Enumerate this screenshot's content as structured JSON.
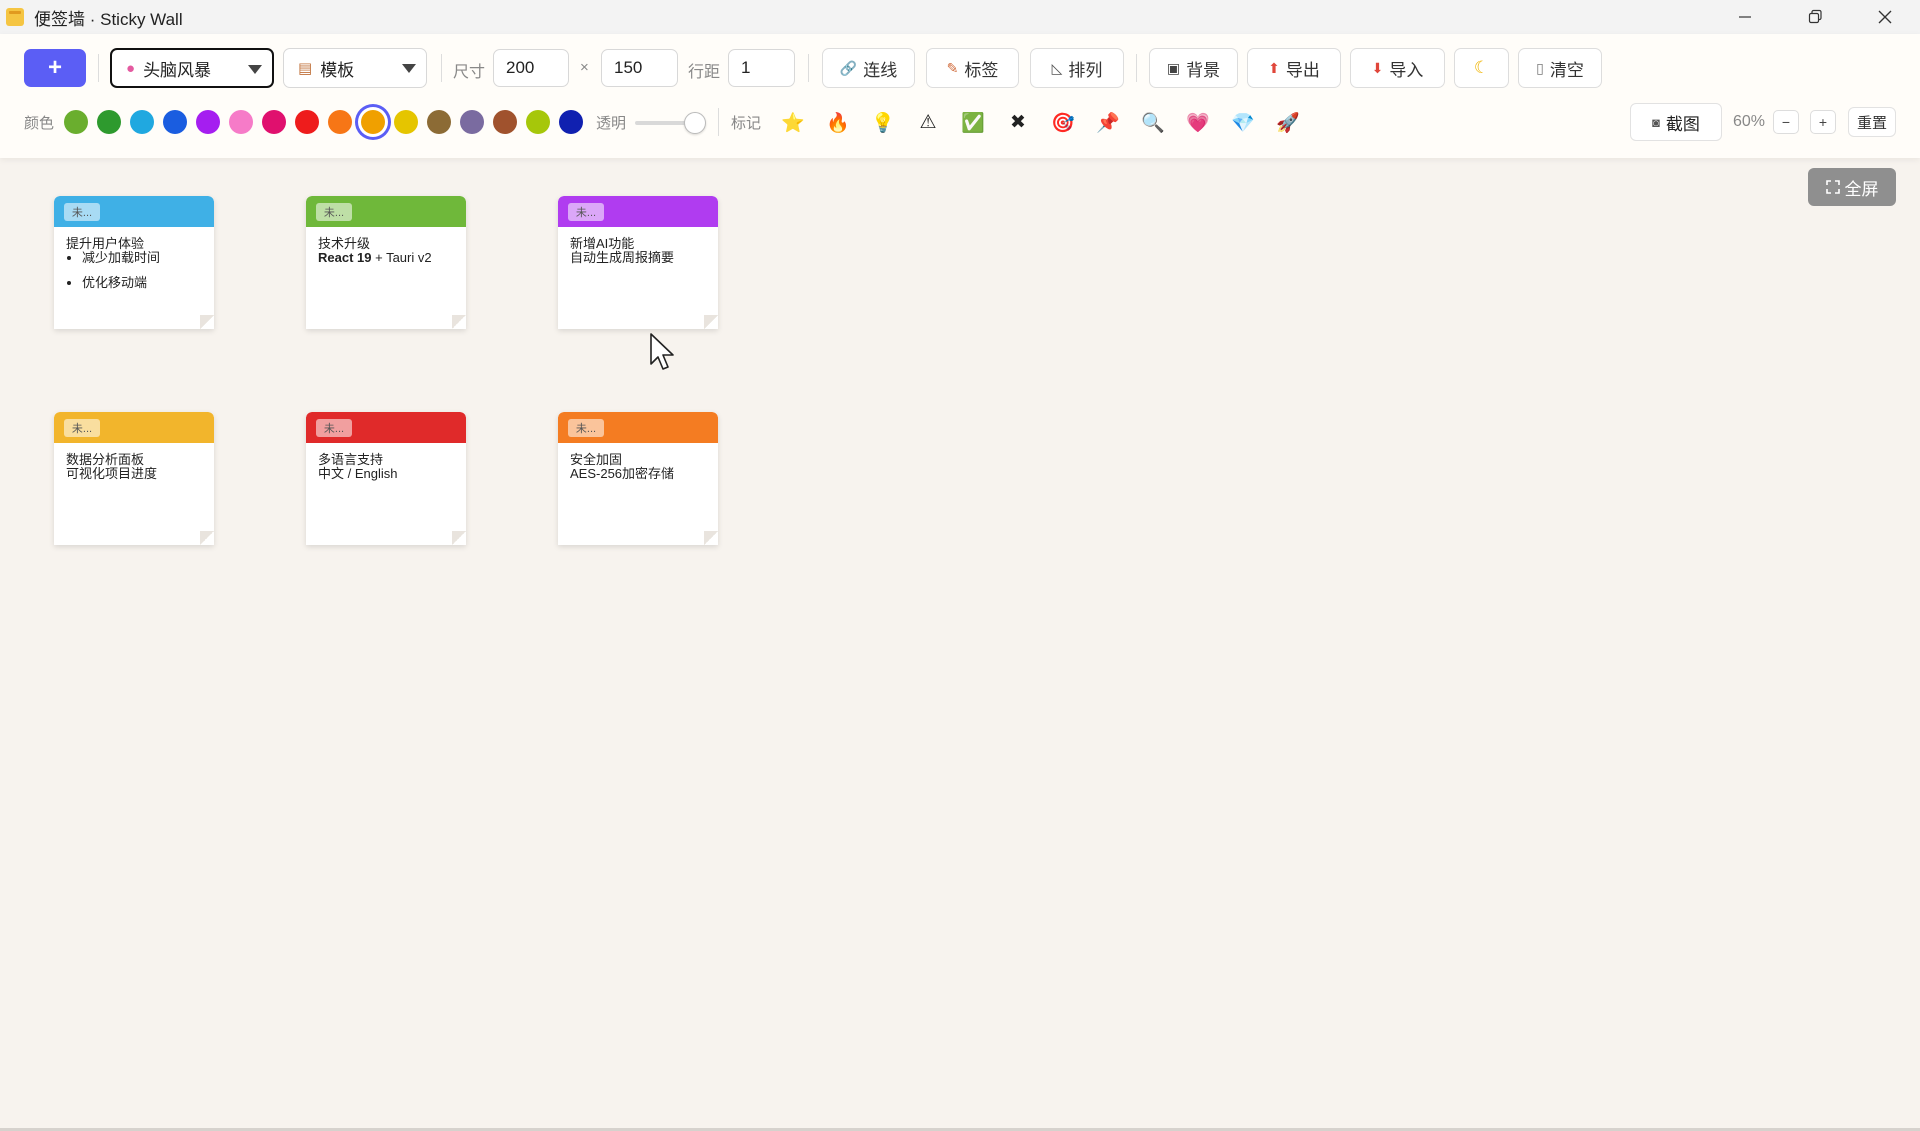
{
  "window": {
    "title": "便签墙 · Sticky Wall",
    "minimize_icon": "minimize-icon",
    "restore_icon": "restore-icon",
    "close_icon": "close-icon"
  },
  "toolbar": {
    "add_label": "+",
    "mode_select": {
      "value": "头脑风暴",
      "icon": "brain-icon"
    },
    "template_select": {
      "value": "模板",
      "icon": "clipboard-icon"
    },
    "size_label": "尺寸",
    "width_value": "200",
    "times": "×",
    "height_value": "150",
    "spacing_label": "行距",
    "spacing_value": "1",
    "link_label": "连线",
    "tag_label": "标签",
    "arrange_label": "排列",
    "background_label": "背景",
    "export_label": "导出",
    "import_label": "导入",
    "theme_icon": "moon-icon",
    "clear_label": "清空",
    "color_label": "颜色",
    "colors": [
      "#6aae2e",
      "#2e9a2e",
      "#20a8e0",
      "#1a5de0",
      "#a51ef0",
      "#f67bc8",
      "#e0106e",
      "#ee1c1c",
      "#f77616",
      "#f0a000",
      "#e5c500",
      "#8c6b35",
      "#7a6ba0",
      "#a0522d",
      "#a6c70a",
      "#1020b0"
    ],
    "selected_color_index": 9,
    "opacity_label": "透明",
    "opacity_value": 1.0,
    "mark_label": "标记",
    "marks": [
      "⭐",
      "🔥",
      "💡",
      "⚠",
      "✅",
      "✖",
      "🎯",
      "📌",
      "🔍",
      "💗",
      "💎",
      "🚀"
    ],
    "mark_names": [
      "star-icon",
      "fire-icon",
      "bulb-icon",
      "warning-icon",
      "check-icon",
      "cross-icon",
      "target-icon",
      "pin-icon",
      "search-icon",
      "heart-icon",
      "diamond-icon",
      "rocket-icon"
    ],
    "screenshot_label": "截图",
    "zoom_value": "60%",
    "zoom_out_label": "−",
    "zoom_in_label": "+",
    "reset_label": "重置"
  },
  "fullscreen_label": "全屏",
  "notes": [
    {
      "tag": "未...",
      "color": "#3fb0e6",
      "line1": "提升用户体验",
      "bullets": [
        "减少加载时间",
        "优化移动端"
      ]
    },
    {
      "tag": "未...",
      "color": "#6fb83a",
      "line1": "技术升级",
      "bold": "React 19",
      "rest": " + Tauri v2"
    },
    {
      "tag": "未...",
      "color": "#b03cf0",
      "line1": "新增AI功能",
      "line2": "自动生成周报摘要"
    },
    {
      "tag": "未...",
      "color": "#f2b52c",
      "line1": "数据分析面板",
      "line2": "可视化项目进度"
    },
    {
      "tag": "未...",
      "color": "#e02a2a",
      "line1": "多语言支持",
      "line2": "中文 / English"
    },
    {
      "tag": "未...",
      "color": "#f47c22",
      "line1": "安全加固",
      "line2": "AES-256加密存储"
    }
  ]
}
